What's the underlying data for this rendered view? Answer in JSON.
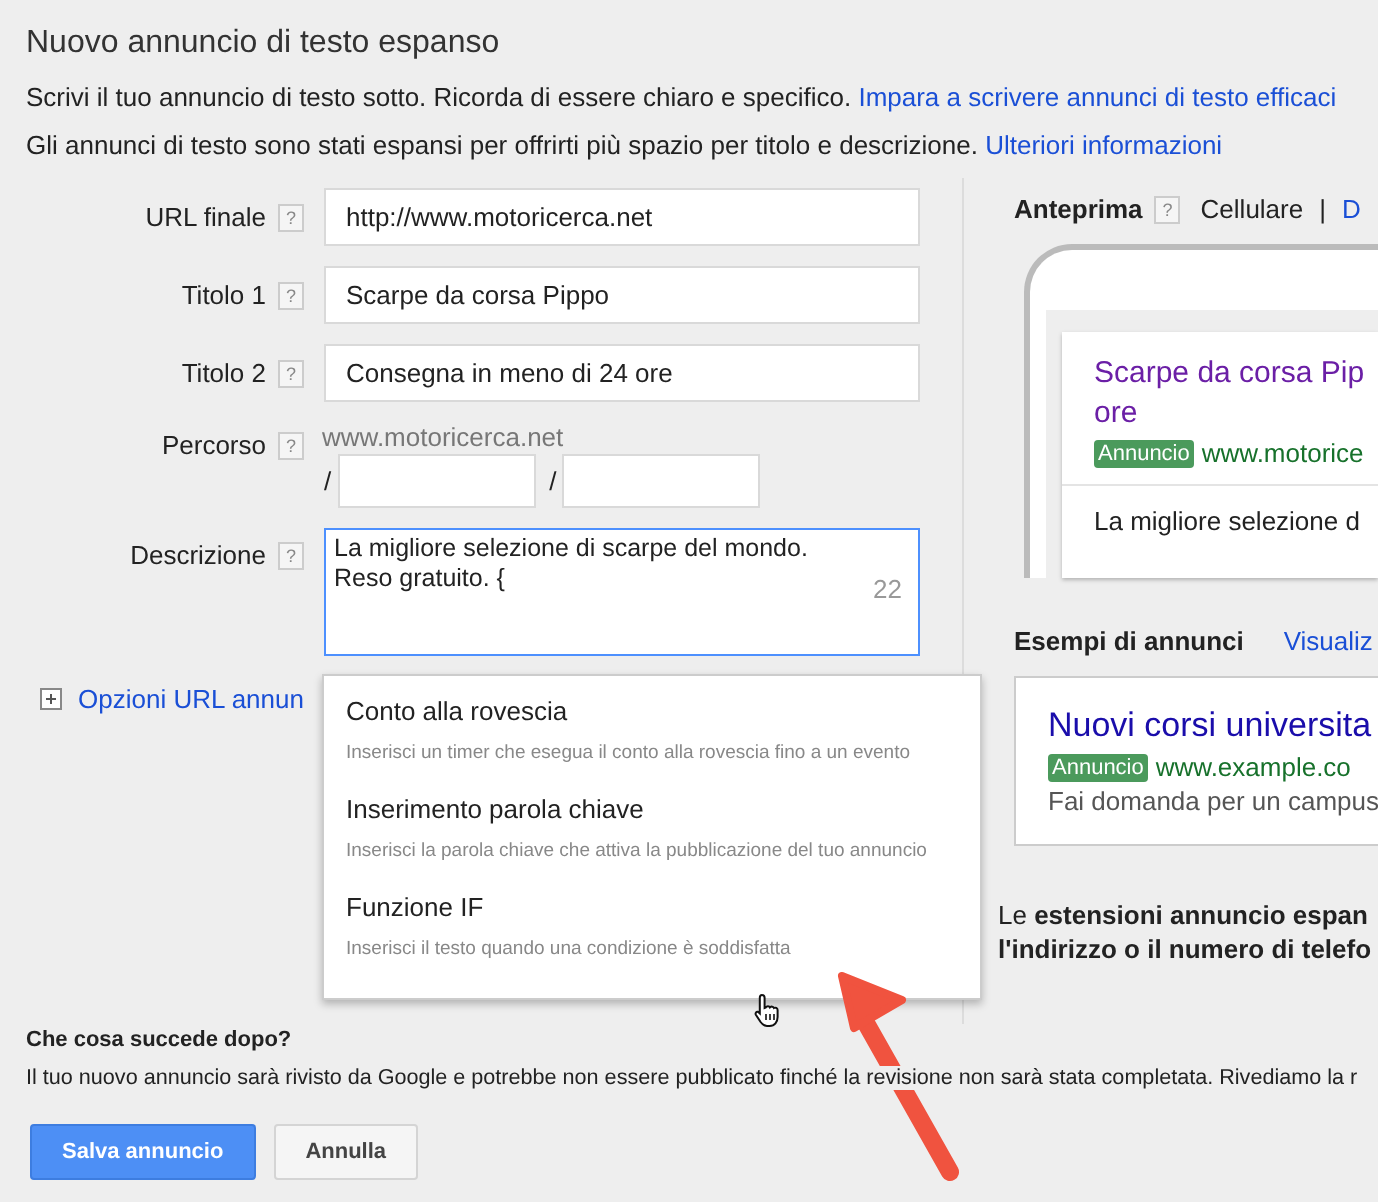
{
  "header": {
    "title": "Nuovo annuncio di testo espanso",
    "lines": [
      {
        "text": "Scrivi il tuo annuncio di testo sotto. Ricorda di essere chiaro e specifico.",
        "link": "Impara a scrivere annunci di testo efficaci"
      },
      {
        "text": "Gli annunci di testo sono stati espansi per offrirti più spazio per titolo e descrizione.",
        "link": "Ulteriori informazioni"
      }
    ]
  },
  "form": {
    "fields": [
      {
        "label": "URL finale",
        "help": "?",
        "value": "http://www.motoricerca.net"
      },
      {
        "label": "Titolo 1",
        "help": "?",
        "value": "Scarpe da corsa Pippo"
      },
      {
        "label": "Titolo 2",
        "help": "?",
        "value": "Consegna in meno di 24 ore"
      }
    ],
    "path": {
      "label": "Percorso",
      "help": "?",
      "domain": "www.motoricerca.net",
      "separators": [
        "/",
        "/"
      ]
    },
    "description": {
      "label": "Descrizione",
      "help": "?",
      "value": "La migliore selezione di scarpe del mondo. Reso gratuito. {",
      "counter": "22",
      "focused": true
    },
    "url_options": {
      "label": "Opzioni URL annun"
    }
  },
  "dropdown": [
    {
      "title": "Conto alla rovescia",
      "desc": "Inserisci un timer che esegua il conto alla rovescia fino a un evento"
    },
    {
      "title": "Inserimento parola chiave",
      "desc": "Inserisci la parola chiave che attiva la pubblicazione del tuo annuncio"
    },
    {
      "title": "Funzione IF",
      "desc": "Inserisci il testo quando una condizione è soddisfatta"
    }
  ],
  "preview": {
    "label": "Anteprima",
    "help": "?",
    "tabs": [
      {
        "label": "Cellulare",
        "selected": true
      },
      {
        "label": "D",
        "selected": false
      }
    ],
    "separator": "|",
    "ad": {
      "title": "Scarpe da corsa Pip",
      "title_2": "ore",
      "badge": "Annuncio",
      "url": "www.motorice",
      "desc": "La migliore selezione d"
    }
  },
  "examples": {
    "label": "Esempi di annunci",
    "link": "Visualiz",
    "ad": {
      "title": "Nuovi corsi universita",
      "badge": "Annuncio",
      "url": "www.example.co",
      "desc": "Fai domanda per un campus"
    }
  },
  "extensions_note": [
    "Le **estensioni annuncio espan**",
    "**l'indirizzo o il numero di telefo**"
  ],
  "next": {
    "title": "Che cosa succede dopo?",
    "text": "Il tuo nuovo annuncio sarà rivisto da Google e potrebbe non essere pubblicato finché la revisione non sarà stata completata. Rivediamo la r"
  },
  "buttons": [
    {
      "label": "Salva annuncio",
      "kind": "primary"
    },
    {
      "label": "Annulla",
      "kind": "secondary"
    }
  ]
}
